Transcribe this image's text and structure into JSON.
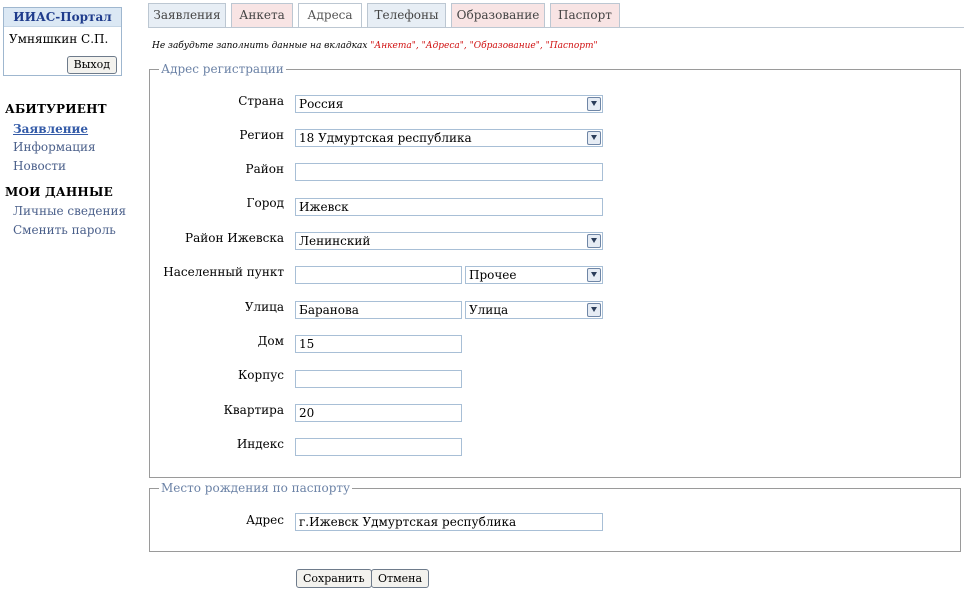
{
  "sidebar": {
    "portal_title": "ИИАС-Портал",
    "user_name": "Умняшкин С.П.",
    "logout_label": "Выход",
    "section1_title": "АБИТУРИЕНТ",
    "section1_items": [
      "Заявление",
      "Информация",
      "Новости"
    ],
    "section2_title": "МОИ ДАННЫЕ",
    "section2_items": [
      "Личные сведения",
      "Сменить пароль"
    ]
  },
  "tabs": [
    "Заявления",
    "Анкета",
    "Адреса",
    "Телефоны",
    "Образование",
    "Паспорт"
  ],
  "active_tab": "Адреса",
  "hint": {
    "prefix": "Не забудьте заполнить данные на вкладках ",
    "tabs_text": "\"Анкета\", \"Адреса\", \"Образование\", \"Паспорт\""
  },
  "registration": {
    "legend": "Адрес регистрации",
    "country_label": "Страна",
    "country_value": "Россия",
    "region_label": "Регион",
    "region_value": "18 Удмуртская республика",
    "district_label": "Район",
    "district_value": "",
    "city_label": "Город",
    "city_value": "Ижевск",
    "city_district_label": "Район Ижевска",
    "city_district_value": "Ленинский",
    "locality_label": "Населенный пункт",
    "locality_value": "",
    "locality_type_value": "Прочее",
    "street_label": "Улица",
    "street_value": "Баранова",
    "street_type_value": "Улица",
    "house_label": "Дом",
    "house_value": "15",
    "building_label": "Корпус",
    "building_value": "",
    "apartment_label": "Квартира",
    "apartment_value": "20",
    "index_label": "Индекс",
    "index_value": ""
  },
  "birthplace": {
    "legend": "Место рождения по паспорту",
    "address_label": "Адрес",
    "address_value": "г.Ижевск Удмуртская республика"
  },
  "actions": {
    "save_label": "Сохранить",
    "cancel_label": "Отмена"
  }
}
